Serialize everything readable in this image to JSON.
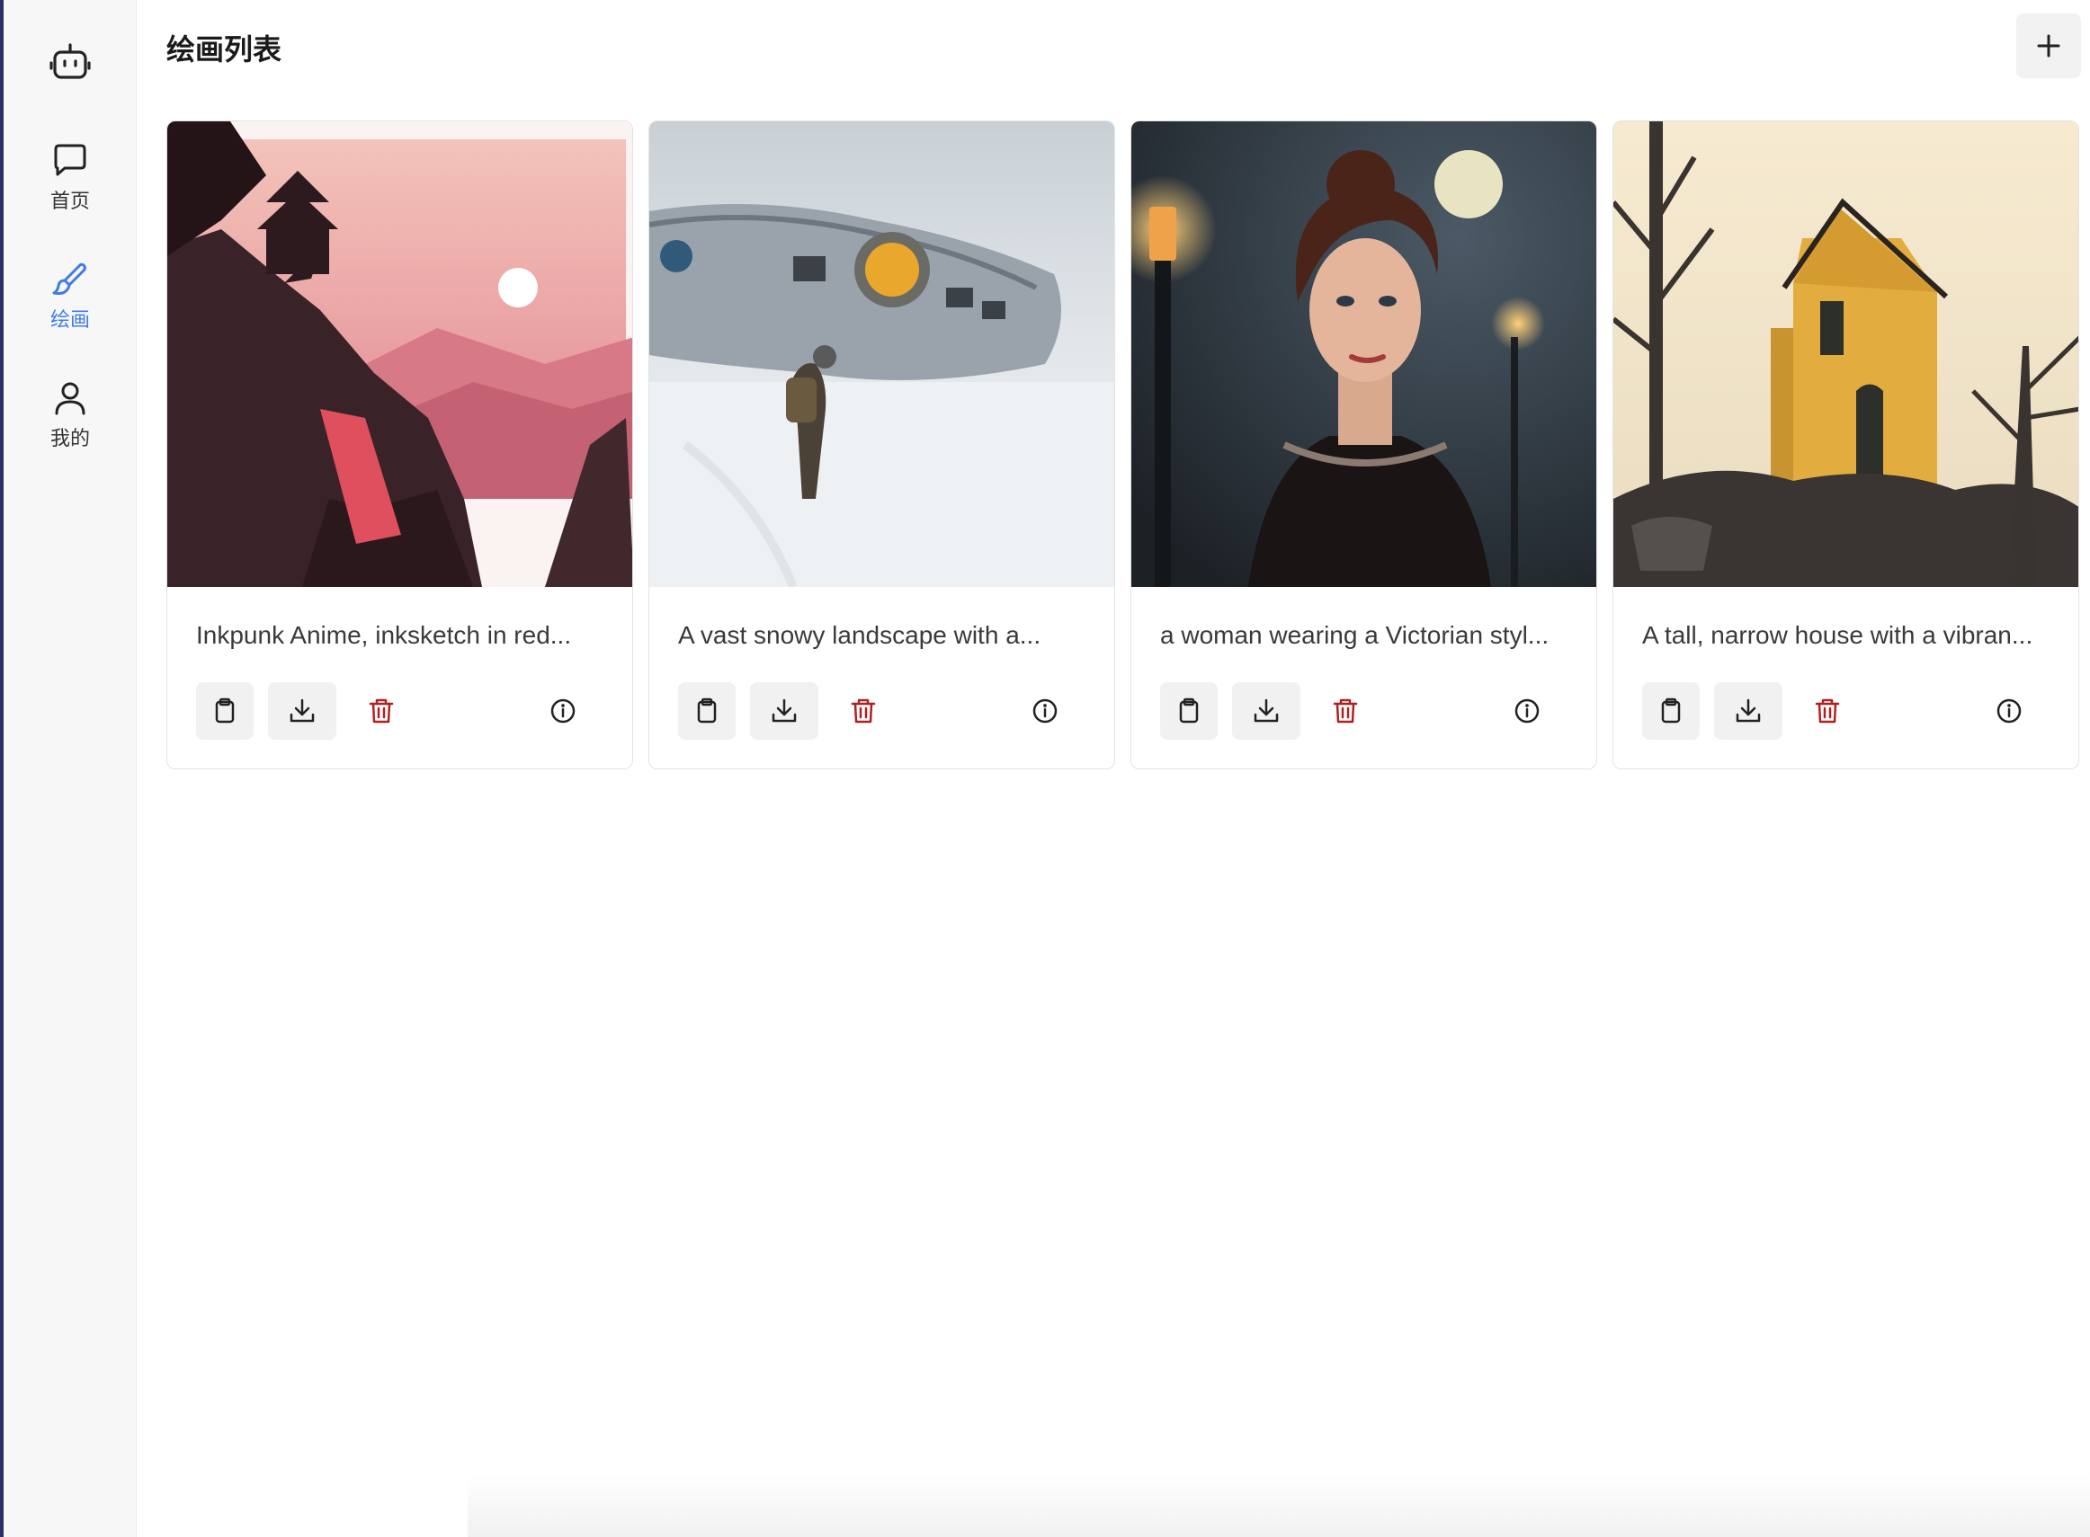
{
  "sidebar": {
    "logo_icon": "robot-icon",
    "items": [
      {
        "label": "首页",
        "icon": "chat-bubble-icon",
        "active": false
      },
      {
        "label": "绘画",
        "icon": "paintbrush-icon",
        "active": true
      },
      {
        "label": "我的",
        "icon": "user-icon",
        "active": false
      }
    ],
    "active_color": "#3f7be8"
  },
  "header": {
    "title": "绘画列表",
    "add_icon": "plus-icon"
  },
  "cards": [
    {
      "prompt": "Inkpunk Anime, inksketch in red...",
      "image": "pagoda-mountain-stairs-sunset"
    },
    {
      "prompt": "A vast snowy landscape with a...",
      "image": "crashed-spaceship-snow-explorer"
    },
    {
      "prompt": "a woman wearing a Victorian styl...",
      "image": "victorian-woman-moon-lanterns"
    },
    {
      "prompt": "A tall, narrow house with a vibran...",
      "image": "yellow-tower-house-bare-trees"
    }
  ],
  "card_actions": [
    "clipboard-icon",
    "download-icon",
    "trash-icon",
    "info-icon"
  ],
  "colors": {
    "delete": "#b02020",
    "accent": "#3f7be8"
  }
}
